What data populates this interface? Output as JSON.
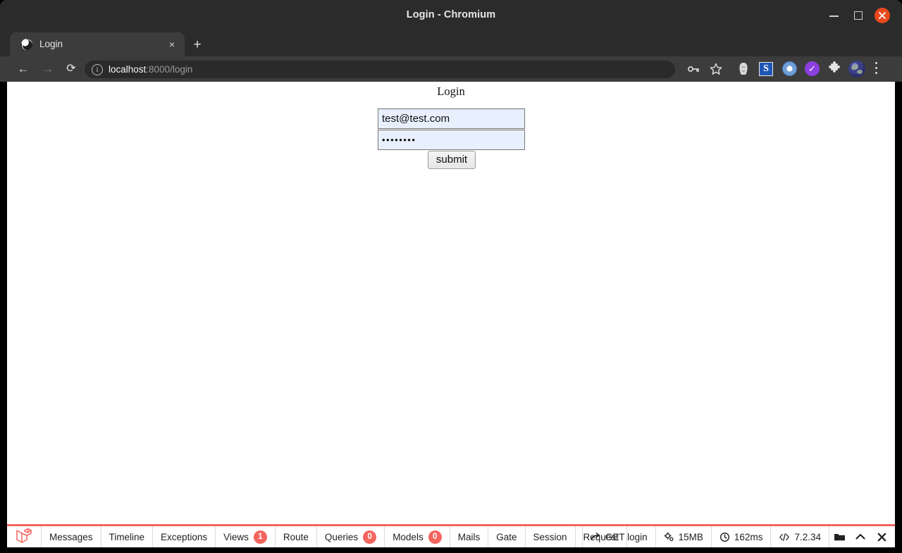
{
  "window": {
    "title": "Login - Chromium",
    "controls": {
      "minimize": "minimize-button",
      "maximize": "maximize-button",
      "close": "close-button"
    },
    "close_color": "#e8491d"
  },
  "browser": {
    "tab": {
      "title": "Login",
      "close_label": "×",
      "favicon": "globe-icon"
    },
    "new_tab_label": "+",
    "nav": {
      "back": "←",
      "forward": "→",
      "reload": "⟳"
    },
    "omnibox": {
      "info_icon": "info-icon",
      "url_host": "localhost",
      "url_path": ":8000/login",
      "full_url": "localhost:8000/login"
    },
    "toolbar_icons": [
      "password-key-icon",
      "bookmark-star-icon",
      "extension-face-icon",
      "extension-s-icon",
      "extension-o-icon",
      "extension-check-icon",
      "extensions-puzzle-icon",
      "profile-avatar",
      "browser-menu-icon"
    ],
    "extension_s_label": "S",
    "extension_check_label": "✓"
  },
  "page": {
    "heading": "Login",
    "form": {
      "email_value": "test@test.com",
      "email_placeholder": "",
      "password_value": "••••••••",
      "password_placeholder": "",
      "submit_label": "submit",
      "autofill_color": "#e8f0fe"
    }
  },
  "debugbar": {
    "accent_color": "#f4645f",
    "logo": "laravel-logo-icon",
    "tabs": [
      {
        "label": "Messages",
        "badge": null
      },
      {
        "label": "Timeline",
        "badge": null
      },
      {
        "label": "Exceptions",
        "badge": null
      },
      {
        "label": "Views",
        "badge": "1"
      },
      {
        "label": "Route",
        "badge": null
      },
      {
        "label": "Queries",
        "badge": "0"
      },
      {
        "label": "Models",
        "badge": "0"
      },
      {
        "label": "Mails",
        "badge": null
      },
      {
        "label": "Gate",
        "badge": null
      },
      {
        "label": "Session",
        "badge": null
      },
      {
        "label": "Request",
        "badge": null
      }
    ],
    "stats": [
      {
        "icon": "request-arrow-icon",
        "label": "GET login"
      },
      {
        "icon": "memory-gears-icon",
        "label": "15MB"
      },
      {
        "icon": "clock-icon",
        "label": "162ms"
      },
      {
        "icon": "code-icon",
        "label": "7.2.34"
      }
    ],
    "controls": [
      "open-folder-icon",
      "collapse-chevron-up-icon",
      "close-debugbar-icon"
    ]
  }
}
